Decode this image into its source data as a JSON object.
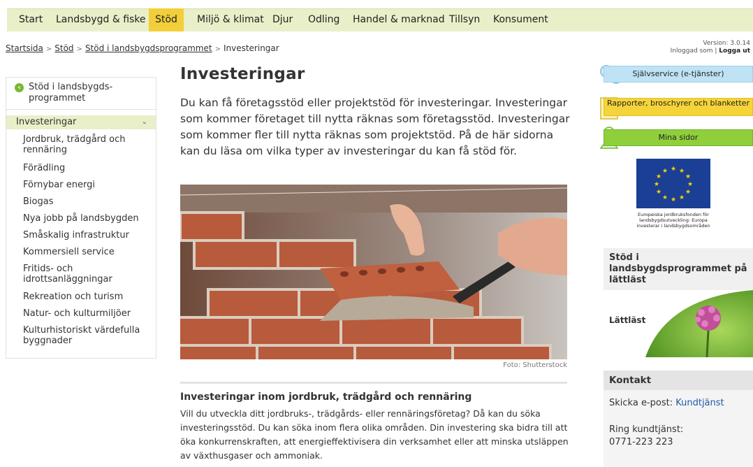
{
  "nav": {
    "items": [
      {
        "label": "Start"
      },
      {
        "label": "Landsbygd & fiske"
      },
      {
        "label": "Stöd",
        "active": true
      },
      {
        "label": "Miljö & klimat"
      },
      {
        "label": "Djur"
      },
      {
        "label": "Odling"
      },
      {
        "label": "Handel & marknad"
      },
      {
        "label": "Tillsyn"
      },
      {
        "label": "Konsument"
      }
    ]
  },
  "breadcrumb": {
    "items": [
      "Startsida",
      "Stöd",
      "Stöd i landsbygdsprogrammet"
    ],
    "current": "Investeringar",
    "separator": ">"
  },
  "session": {
    "version": "Version: 3.0.14",
    "logged_in_label": "Inloggad som",
    "logout_label": "Logga ut"
  },
  "sidebar": {
    "parent_label": "Stöd i landsbygds-programmet",
    "active_label": "Investeringar",
    "items": [
      {
        "label": "Jordbruk, trädgård och rennäring"
      },
      {
        "label": "Förädling"
      },
      {
        "label": "Förnybar energi"
      },
      {
        "label": "Biogas"
      },
      {
        "label": "Nya jobb på landsbygden"
      },
      {
        "label": "Småskalig infrastruktur"
      },
      {
        "label": "Kommersiell service"
      },
      {
        "label": "Fritids- och idrottsanläggningar"
      },
      {
        "label": "Rekreation och turism"
      },
      {
        "label": "Natur- och kulturmiljöer"
      },
      {
        "label": "Kulturhistoriskt värdefulla byggnader"
      }
    ]
  },
  "main": {
    "title": "Investeringar",
    "lead": "Du kan få företagsstöd eller projektstöd för investeringar. Investeringar som kommer företaget till nytta räknas som företagsstöd. Investeringar som kommer fler till nytta räknas som projektstöd. På de här sidorna kan du läsa om vilka typer av investeringar du kan få stöd för.",
    "image_caption": "Foto: Shutterstock",
    "section_heading": "Investeringar inom jordbruk, trädgård och rennäring",
    "section_text": "Vill du utveckla ditt jordbruks-, trädgårds- eller rennäringsföretag? Då kan du söka investeringsstöd. Du kan söka inom flera olika områden. Din investering ska bidra till att öka konkurrenskraften, att energieffektivisera din verksamhet eller att minska utsläppen av växthusgaser och ammoniak."
  },
  "right": {
    "selfservice_label": "Självservice (e-tjänster)",
    "reports_label": "Rapporter, broschyrer och blanketter",
    "mypages_label": "Mina sidor",
    "eu_text": "Europeiska jordbruksfonden för landsbygdsutveckling: Europa investerar i landsbygdsområden",
    "lattlast_title": "Stöd i landsbygdsprogrammet på lättläst",
    "lattlast_label": "Lättläst",
    "contact_heading": "Kontakt",
    "email_prefix": "Skicka e-post:",
    "email_link": "Kundtjänst",
    "phone_label": "Ring kundtjänst:",
    "phone_number": "0771-223 223"
  },
  "colors": {
    "nav_bg": "#e9efc8",
    "nav_active": "#f2cf3a",
    "selfservice": "#bfe3f5",
    "reports": "#f5d43a",
    "mypages": "#8fcf3c",
    "link": "#1f5aa8"
  },
  "icons": {
    "back": "back-arrow-icon",
    "selfservice": "gears-icon",
    "reports": "document-icon",
    "mypages": "person-icon",
    "chevron": "chevron-down-icon"
  }
}
